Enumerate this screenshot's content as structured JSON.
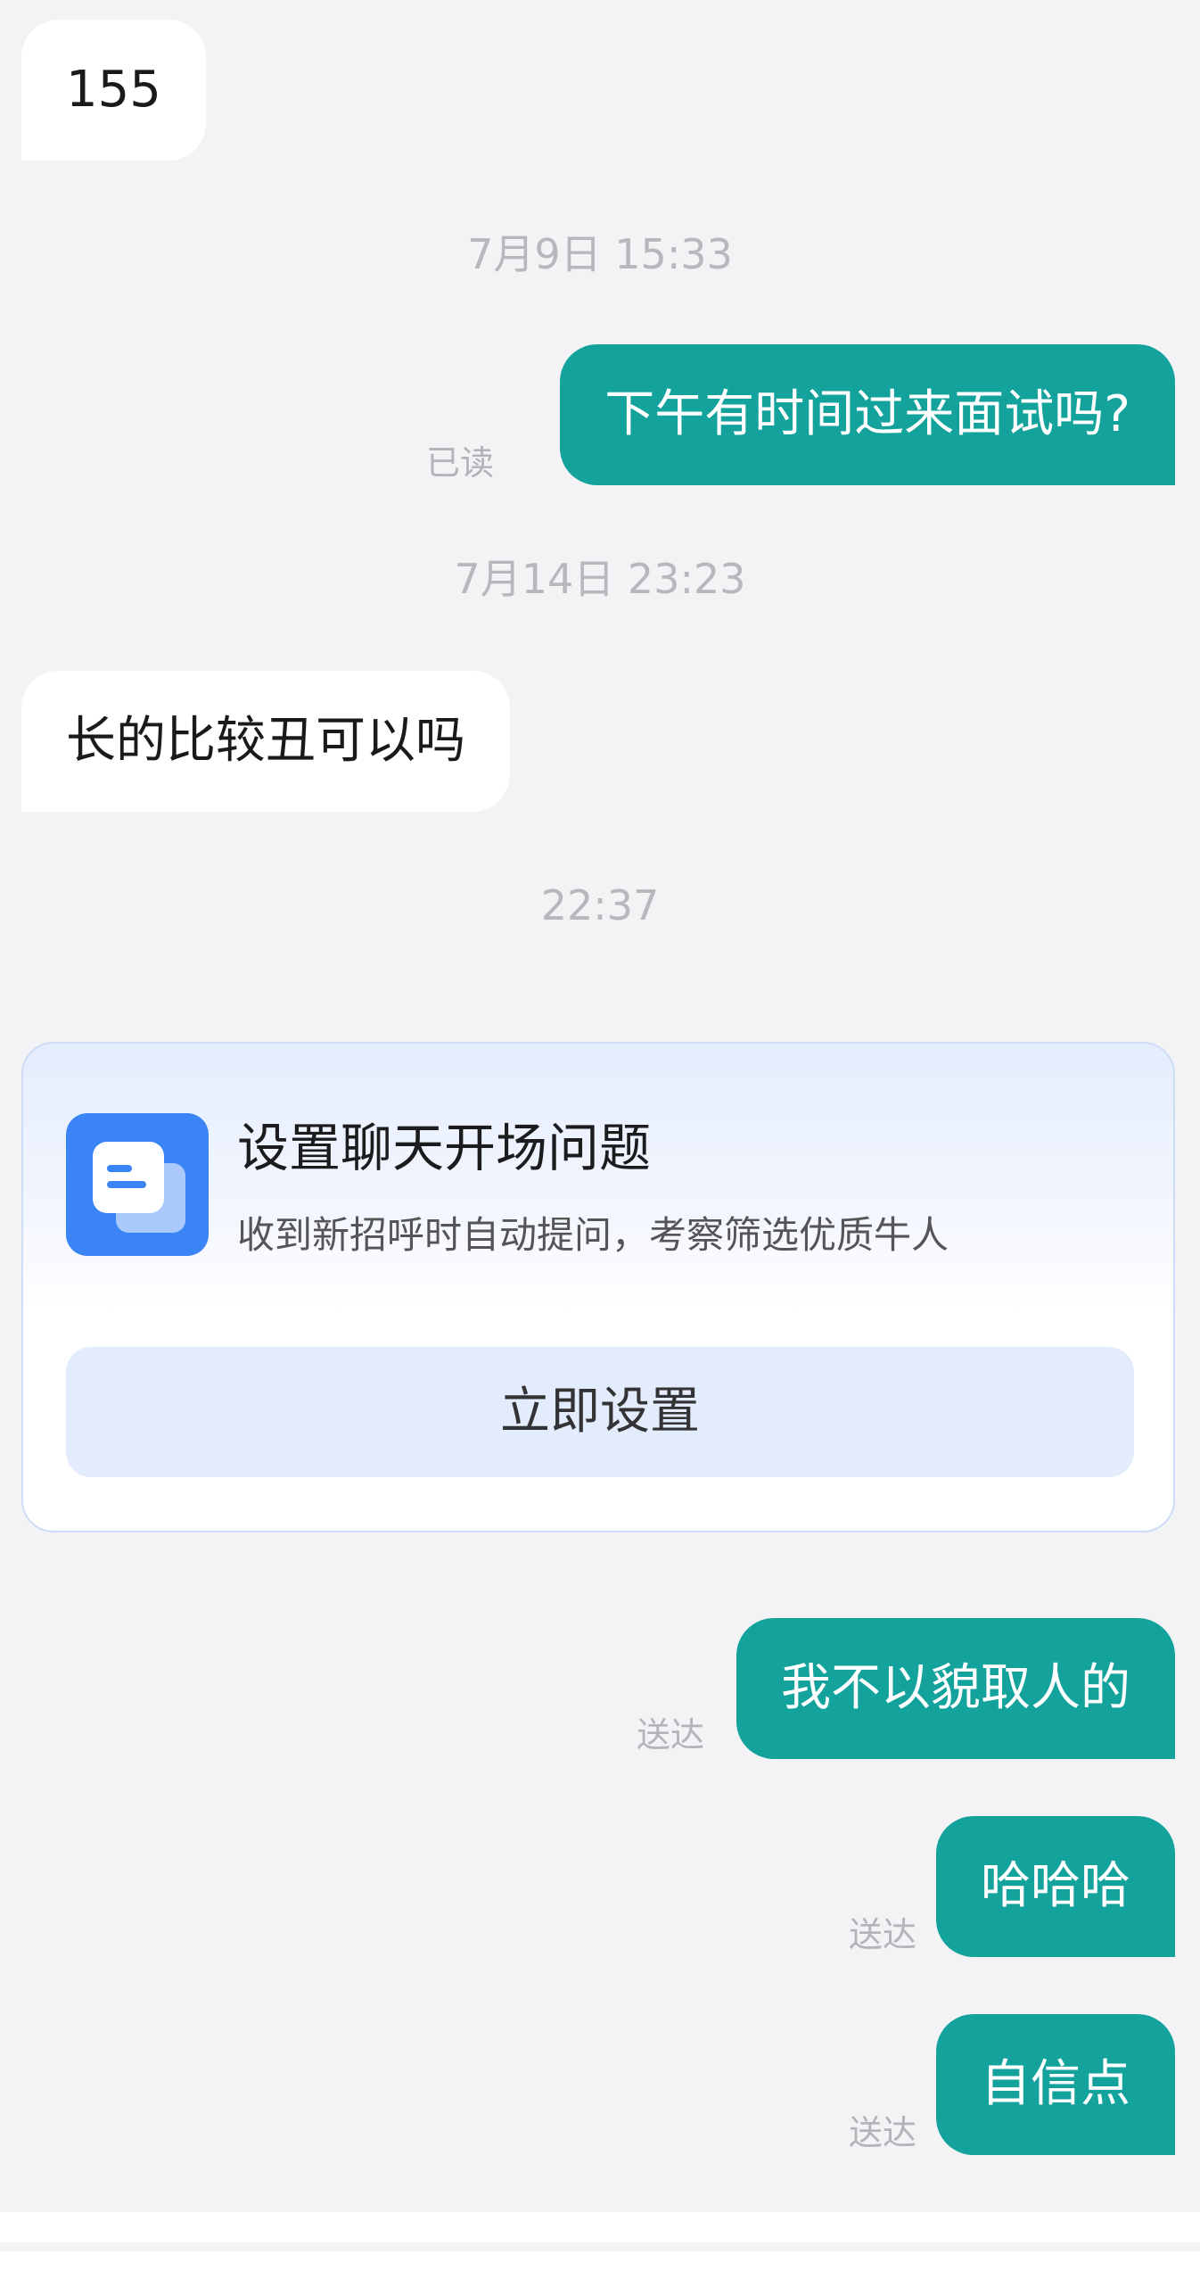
{
  "messages": [
    {
      "id": "m1",
      "direction": "in",
      "text": "155"
    },
    {
      "id": "ts1",
      "type": "timestamp",
      "text": "7月9日 15:33"
    },
    {
      "id": "m2",
      "direction": "out",
      "text": "下午有时间过来面试吗?",
      "status": "已读"
    },
    {
      "id": "ts2",
      "type": "timestamp",
      "text": "7月14日 23:23"
    },
    {
      "id": "m3",
      "direction": "in",
      "text": "长的比较丑可以吗"
    },
    {
      "id": "ts3",
      "type": "timestamp",
      "text": "22:37"
    },
    {
      "id": "m4",
      "direction": "out",
      "text": "我不以貌取人的",
      "status": "送达"
    },
    {
      "id": "m5",
      "direction": "out",
      "text": "哈哈哈",
      "status": "送达"
    },
    {
      "id": "m6",
      "direction": "out",
      "text": "自信点",
      "status": "送达"
    }
  ],
  "card": {
    "title": "设置聊天开场问题",
    "description": "收到新招呼时自动提问，考察筛选优质牛人",
    "button_label": "立即设置",
    "icon": "chat-document-icon",
    "colors": {
      "icon_bg": "#3a84f6",
      "button_bg": "#e3ecfd",
      "border": "#cfdcf6"
    }
  },
  "colors": {
    "outgoing_bubble": "#13a39c",
    "incoming_bubble": "#ffffff",
    "background": "#f3f3f6",
    "timestamp_text": "#b8b8bc"
  }
}
